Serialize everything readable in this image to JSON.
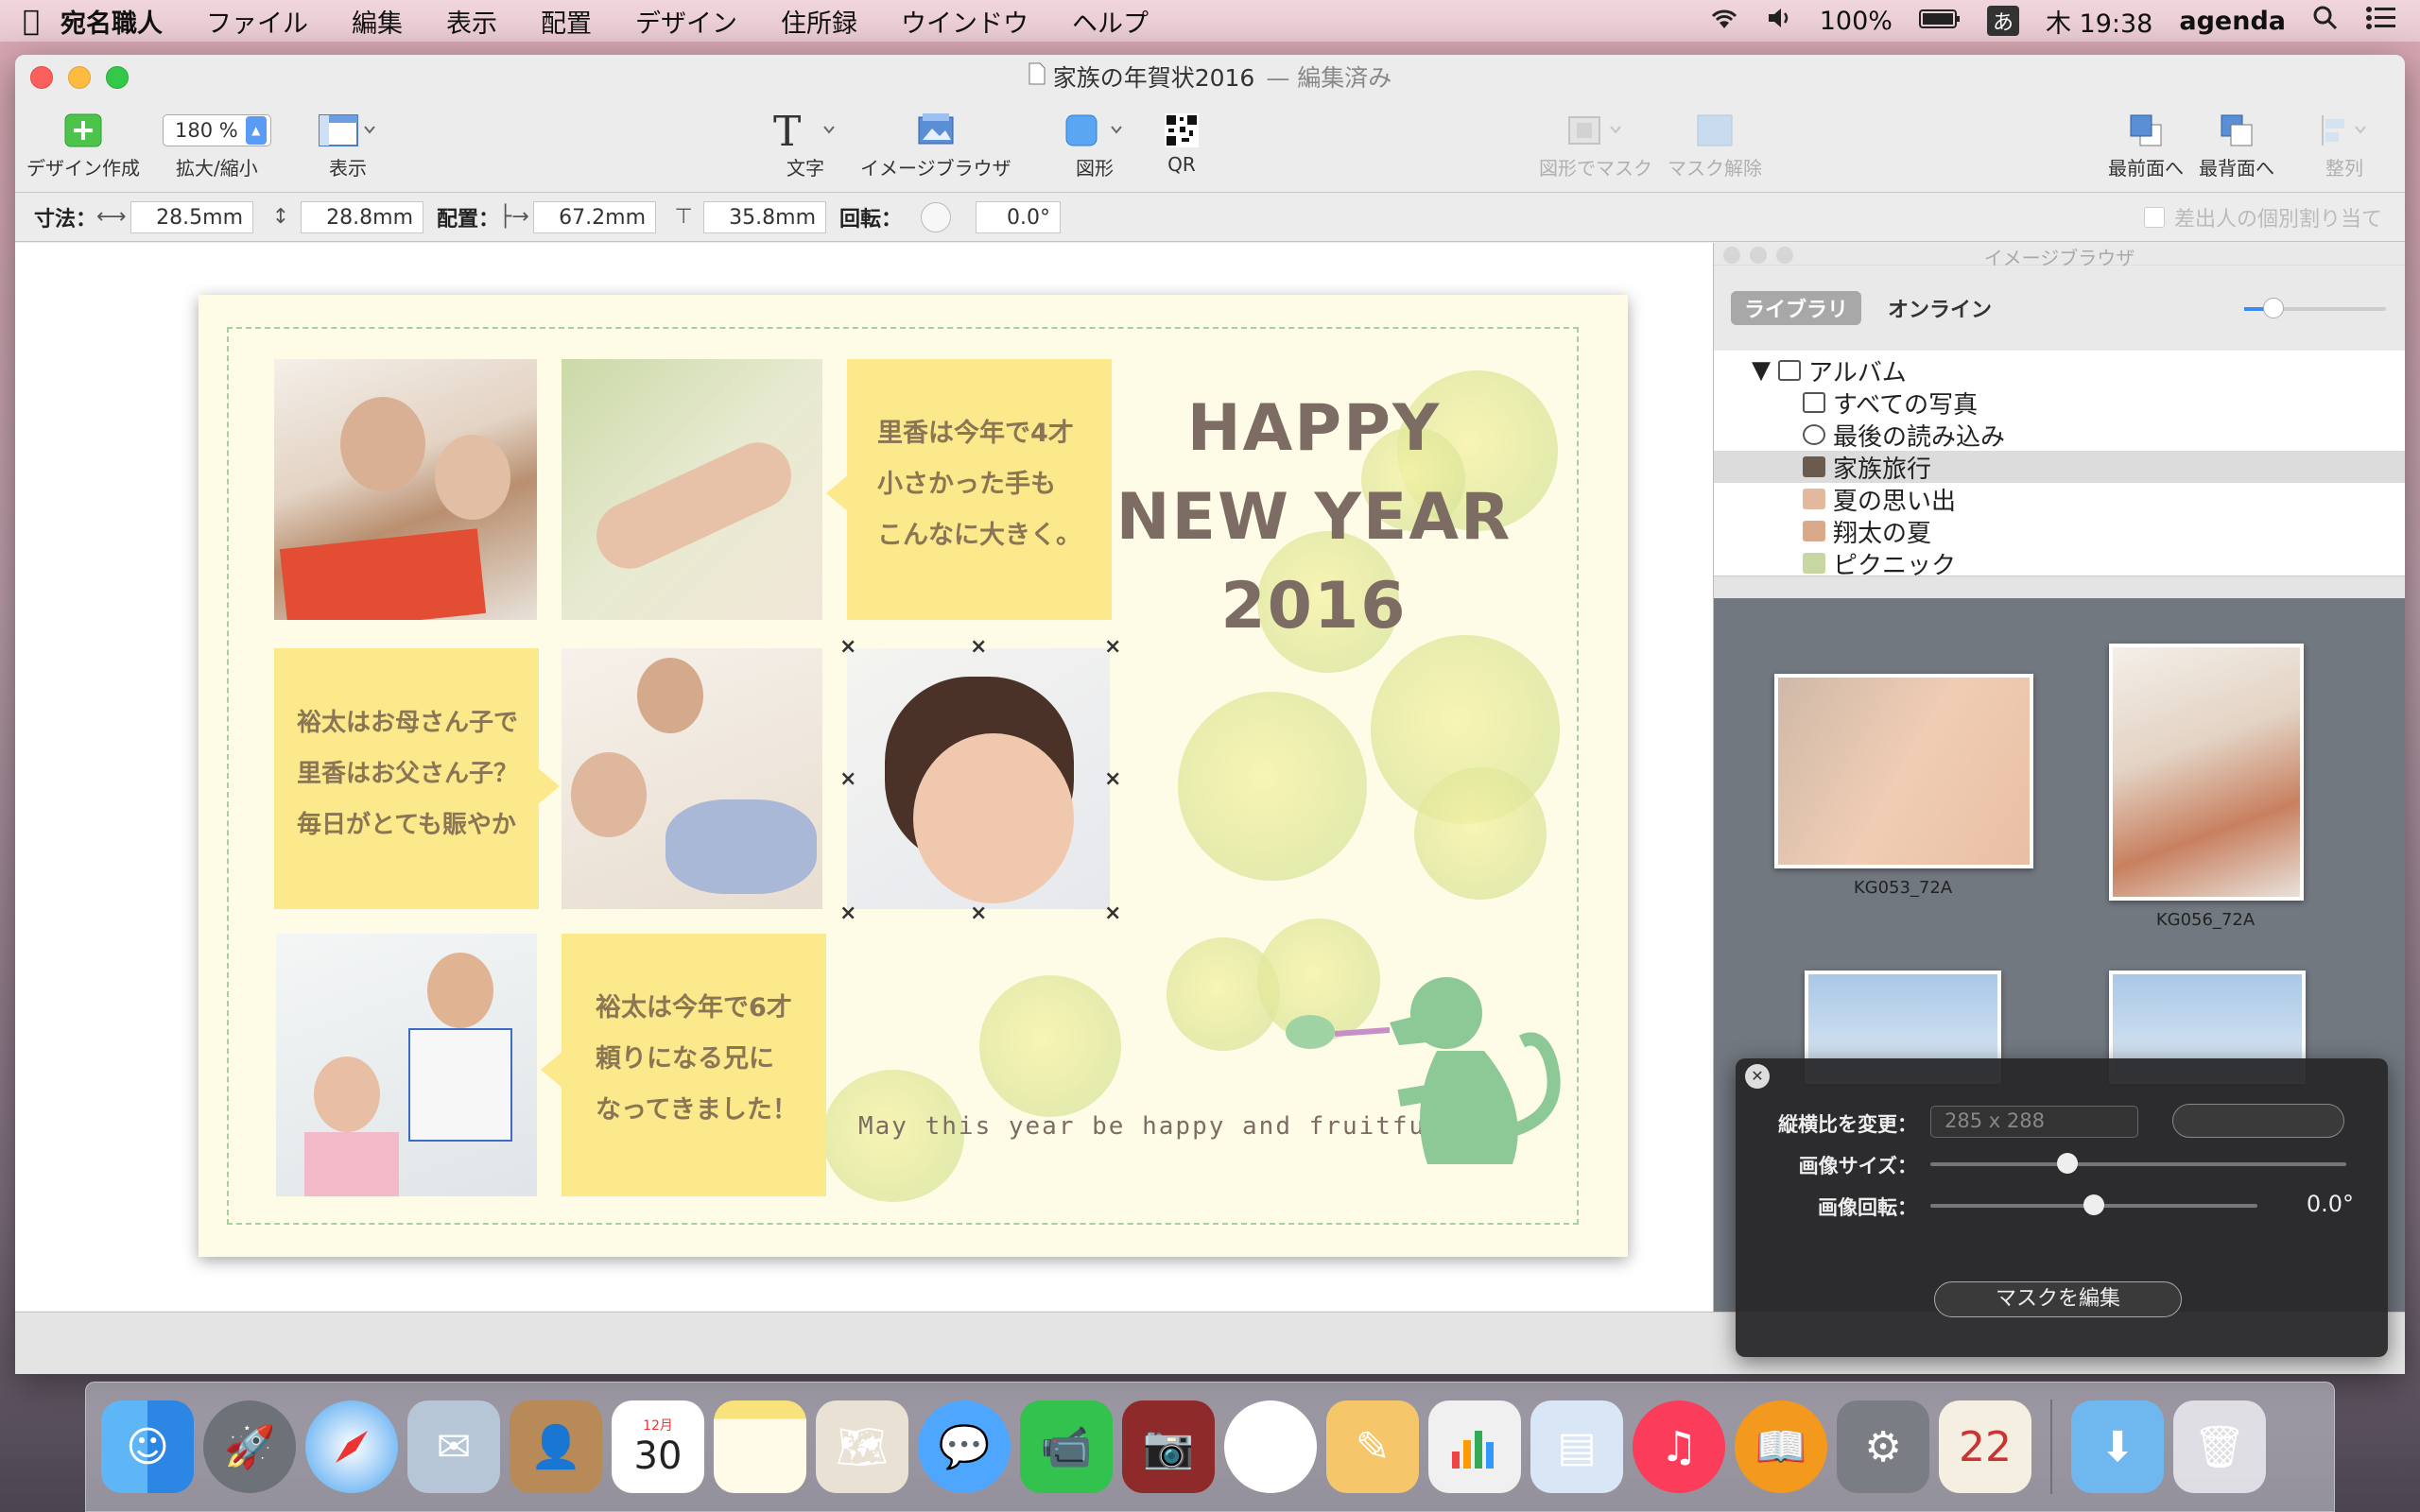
{
  "menubar": {
    "app": "宛名職人",
    "items": [
      "ファイル",
      "編集",
      "表示",
      "配置",
      "デザイン",
      "住所録",
      "ウインドウ",
      "ヘルプ"
    ],
    "battery": "100%",
    "ime": "あ",
    "clock": "木 19:38",
    "user": "agenda"
  },
  "window": {
    "title": "家族の年賀状2016",
    "edited": "— 編集済み"
  },
  "toolbar": {
    "design": "デザイン作成",
    "zoom_label": "拡大/縮小",
    "zoom_value": "180 %",
    "view": "表示",
    "text": "文字",
    "image_browser": "イメージブラウザ",
    "shape": "図形",
    "qr": "QR",
    "mask": "図形でマスク",
    "unmask": "マスク解除",
    "front": "最前面へ",
    "back": "最背面へ",
    "align": "整列"
  },
  "props": {
    "size_label": "寸法：",
    "width": "28.5mm",
    "height": "28.8mm",
    "pos_label": "配置：",
    "x": "67.2mm",
    "y": "35.8mm",
    "rot_label": "回転：",
    "rotation": "0.0°",
    "assign": "差出人の個別割り当て"
  },
  "card": {
    "bubble1": [
      "里香は今年で4才",
      "小さかった手も",
      "こんなに大きく。"
    ],
    "bubble2": [
      "裕太はお母さん子で",
      "里香はお父さん子？",
      "毎日がとても賑やか"
    ],
    "bubble3": [
      "裕太は今年で6才",
      "頼りになる兄に",
      "なってきました！"
    ],
    "happy": [
      "HAPPY",
      "NEW YEAR",
      "2016"
    ],
    "greeting": "May this year be happy and fruitful!"
  },
  "image_browser": {
    "title": "イメージブラウザ",
    "tab_library": "ライブラリ",
    "tab_online": "オンライン",
    "tree": [
      "アルバム",
      "すべての写真",
      "最後の読み込み",
      "家族旅行",
      "夏の思い出",
      "翔太の夏",
      "ピクニック"
    ],
    "thumb1": "KG053_72A",
    "thumb2": "KG056_72A"
  },
  "hud": {
    "aspect_label": "縦横比を変更：",
    "aspect_value": "285 x 288",
    "size_label": "画像サイズ：",
    "rotate_label": "画像回転：",
    "rotate_value": "0.0°",
    "edit_mask": "マスクを編集",
    "size_level": 0.33,
    "rotate_level": 0.5
  },
  "dock": {
    "calendar_month": "12月",
    "calendar_day": "30"
  }
}
